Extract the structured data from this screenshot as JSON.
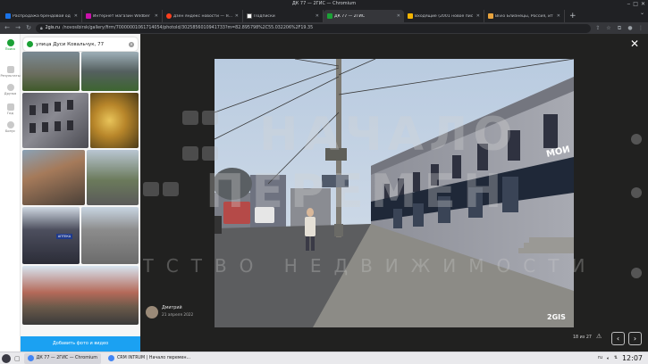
{
  "window": {
    "title": "ДК 77 — 2ГИС — Chromium"
  },
  "tabs": [
    {
      "label": "Распродажа брендовой од",
      "color": "#1a73e8",
      "active": false
    },
    {
      "label": "Интернет магазин Wildber",
      "color": "#cb11ab",
      "active": false
    },
    {
      "label": "дзен яндекс новости — Янд",
      "color": "#fc3f1d",
      "active": false
    },
    {
      "label": "Подписки",
      "color": "#ffffff",
      "active": false
    },
    {
      "label": "ДК 77 — 2ГИС",
      "color": "#1ba136",
      "active": true
    },
    {
      "label": "Входящие (2001 новое пис",
      "color": "#f4b400",
      "active": false
    },
    {
      "label": "Bivio Близнецы, Россия, ит",
      "color": "#e8a33d",
      "active": false
    }
  ],
  "address": {
    "domain": "2gis.ru",
    "path": "/novosibirsk/gallery/firm/70000001061714054/photoId/3025856010941733?m=82.895798%2C55.032206%2F19.35"
  },
  "rail": {
    "items": [
      {
        "label": "Поиск",
        "color": "#1ba136"
      },
      {
        "label": "Результаты",
        "color": "#9a9a9a"
      },
      {
        "label": "Друзья",
        "color": "#9a9a9a"
      },
      {
        "label": "Гид",
        "color": "#9a9a9a"
      },
      {
        "label": "Бонус",
        "color": "#9a9a9a"
      }
    ]
  },
  "search": {
    "value": "улица Дуси Ковальчук, 77"
  },
  "panel": {
    "add_button": "Добавить фото и видео"
  },
  "viewer": {
    "author": "Дмитрий",
    "date": "21 апреля 2022",
    "counter": "18 из 27",
    "brand_logo": "2GIS",
    "facade_sign": "МОИ"
  },
  "watermark": {
    "line1": "НАЧАЛО",
    "line2": "ПЕРЕМЕН",
    "line3": "АГЕНТСТВО НЕДВИЖИМОСТИ"
  },
  "taskbar": {
    "items": [
      {
        "label": "ДК 77 — 2ГИС — Chromium",
        "active": true
      },
      {
        "label": "CRM INTRUM | Начало перемен...",
        "active": false
      }
    ],
    "lang": "ru",
    "clock": "12:07"
  },
  "colors": {
    "accent": "#1ba136",
    "button": "#1ba1f2",
    "chrome_dark": "#202124"
  }
}
